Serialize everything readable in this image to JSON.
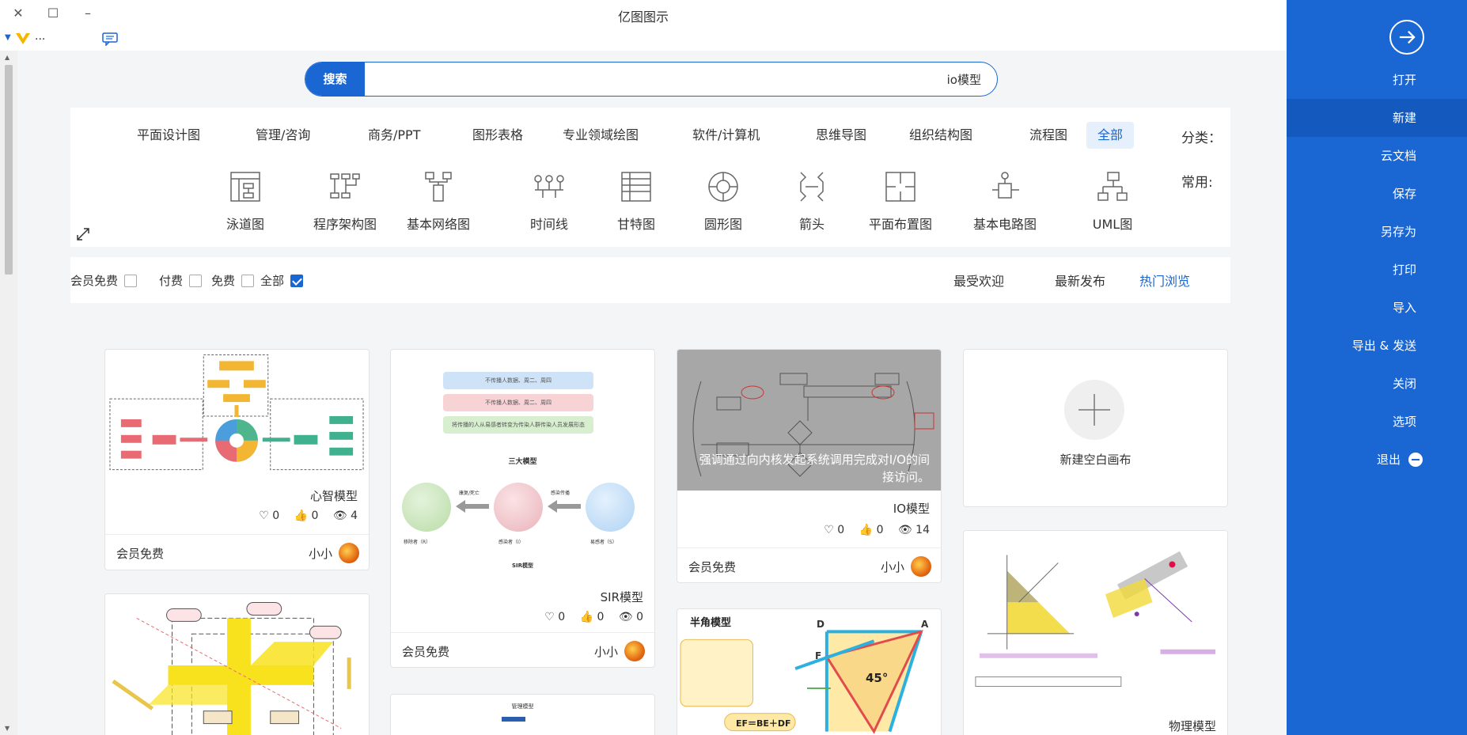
{
  "window": {
    "title": "亿图图示"
  },
  "quickbar": {
    "more": "..."
  },
  "search": {
    "button": "搜索",
    "value": "io模型"
  },
  "categories": {
    "label": "分类：",
    "items": [
      "全部",
      "流程图",
      "组织结构图",
      "思维导图",
      "软件/计算机",
      "专业领域绘图",
      "图形表格",
      "商务/PPT",
      "管理/咨询",
      "平面设计图"
    ],
    "active": "全部"
  },
  "common": {
    "label": "常用:",
    "items": [
      "UML图",
      "基本电路图",
      "平面布置图",
      "箭头",
      "圆形图",
      "甘特图",
      "时间线",
      "基本网络图",
      "程序架构图",
      "泳道图"
    ]
  },
  "sort": {
    "tabs": [
      "热门浏览",
      "最新发布",
      "最受欢迎"
    ],
    "active": "热门浏览"
  },
  "filters": {
    "items": [
      "全部",
      "免费",
      "付费",
      "会员免费"
    ],
    "checked": "全部"
  },
  "new_canvas": {
    "label": "新建空白画布"
  },
  "cards": [
    {
      "title": "IO模型",
      "overlay": "强调通过向内核发起系统调用完成对I/O的间接访问。",
      "views": "14",
      "likes": "0",
      "favs": "0",
      "author": "小小",
      "price": "会员免费"
    },
    {
      "title": "SIR模型",
      "views": "0",
      "likes": "0",
      "favs": "0",
      "author": "小小",
      "price": "会员免费",
      "thumb_texts": {
        "box1": "不传播人数据、周二、周四",
        "box2": "不传播人数据、周二、周四",
        "box3": "将传播的人从易感者转变为传染人群传染人员发展形态",
        "heading": "三大模型",
        "c1": "易感者（S）",
        "c2": "感染者（I）",
        "c3": "移除者（R）",
        "a1": "感染传播",
        "a2": "康复/死亡",
        "foot": "SIR模型"
      }
    },
    {
      "title": "心智模型",
      "views": "4",
      "likes": "0",
      "favs": "0",
      "author": "小小",
      "price": "会员免费"
    },
    {
      "title": "物理模型",
      "partial": true
    },
    {
      "title": "半角模型",
      "partial": true,
      "thumb_texts": {
        "angle": "45°",
        "formula": "EF＝BE＋DF",
        "d": "D",
        "a": "A",
        "f": "F"
      }
    },
    {
      "title": "",
      "partial": true,
      "thumb_texts": {
        "heading": "管理模型"
      }
    },
    {
      "title": "",
      "partial": true
    }
  ],
  "sidebar": {
    "items": [
      "打开",
      "新建",
      "云文档",
      "保存",
      "另存为",
      "打印",
      "导入",
      "导出 & 发送",
      "关闭",
      "选项",
      "退出"
    ],
    "active": "新建"
  }
}
